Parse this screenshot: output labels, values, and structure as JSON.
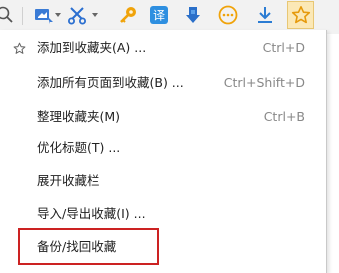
{
  "toolbar": {
    "icons": [
      {
        "name": "search-icon"
      },
      {
        "name": "screenshot-icon"
      },
      {
        "name": "scissors-icon"
      },
      {
        "name": "key-icon"
      },
      {
        "name": "translate-icon"
      },
      {
        "name": "download-bird-icon"
      },
      {
        "name": "more-icon"
      },
      {
        "name": "download-icon"
      },
      {
        "name": "favorite-star-icon"
      }
    ],
    "accent": "#f2a81d",
    "blue": "#2b7cd3"
  },
  "menu": {
    "items": [
      {
        "label": "添加到收藏夹(A) ...",
        "shortcut": "Ctrl+D",
        "has_star": true
      },
      {
        "label": "添加所有页面到收藏(B) ...",
        "shortcut": "Ctrl+Shift+D"
      },
      {
        "label": "整理收藏夹(M)",
        "shortcut": "Ctrl+B"
      },
      {
        "label": "优化标题(T) ...",
        "shortcut": ""
      },
      {
        "label": "展开收藏栏",
        "shortcut": ""
      },
      {
        "label": "导入/导出收藏(I) ...",
        "shortcut": ""
      },
      {
        "label": "备份/找回收藏",
        "shortcut": "",
        "highlighted": true
      }
    ],
    "highlight_color": "#cc2222"
  }
}
